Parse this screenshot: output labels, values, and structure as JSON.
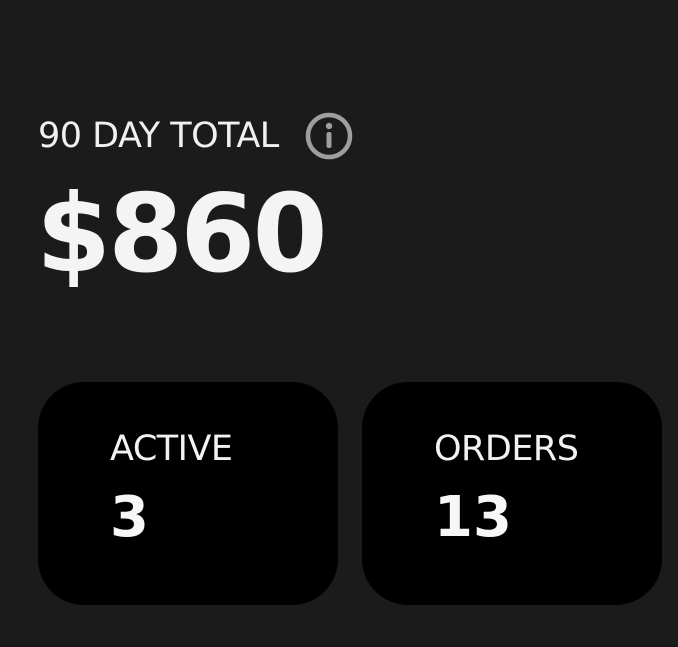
{
  "summary": {
    "label": "90 DAY TOTAL",
    "info_icon": "info-icon",
    "amount": "$860"
  },
  "stats": {
    "active": {
      "label": "ACTIVE",
      "value": "3"
    },
    "orders": {
      "label": "ORDERS",
      "value": "13"
    }
  },
  "colors": {
    "background": "#1b1b1b",
    "card": "#000000",
    "text": "#f2f2f2",
    "icon": "#9e9e9e"
  }
}
